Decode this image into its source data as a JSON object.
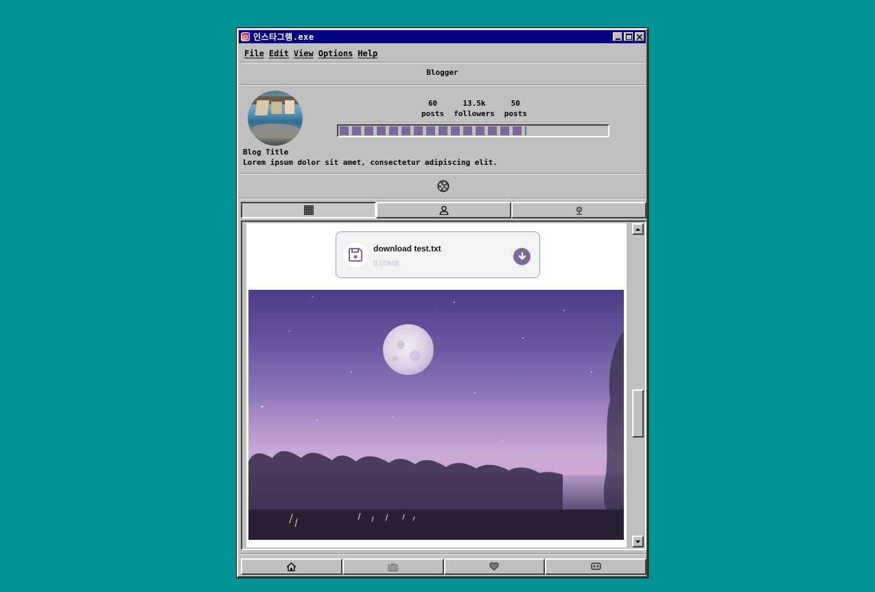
{
  "window": {
    "title": "인스타그램.exe",
    "app_icon": "instagram-icon",
    "controls": [
      "minimize-icon",
      "maximize-icon",
      "close-icon"
    ]
  },
  "menu": {
    "items": [
      {
        "label": "File"
      },
      {
        "label": "Edit"
      },
      {
        "label": "View"
      },
      {
        "label": "Options"
      },
      {
        "label": "Help"
      }
    ]
  },
  "header": {
    "title": "Blogger"
  },
  "profile": {
    "stats": [
      {
        "value": "60",
        "label": "posts"
      },
      {
        "value": "13.5k",
        "label": "followers"
      },
      {
        "value": "50",
        "label": "posts"
      }
    ],
    "progress_fraction": 0.7,
    "blog_title": "Blog Title",
    "description": "Lorem ipsum dolor sit amet, consectetur adipiscing elit.",
    "website_icon": "globe-icon"
  },
  "tabs": [
    {
      "icon": "grid-icon",
      "active": true
    },
    {
      "icon": "user-icon",
      "active": false
    },
    {
      "icon": "location-pin-icon",
      "active": false
    }
  ],
  "download": {
    "icon": "floppy-disk-icon",
    "filename": "download test.txt",
    "size": "0.00MB",
    "action_icon": "download-arrow-icon"
  },
  "post": {
    "image": "moon-night-sky-photo"
  },
  "bottom_nav": [
    {
      "icon": "home-icon"
    },
    {
      "icon": "tv-icon"
    },
    {
      "icon": "heart-icon"
    },
    {
      "icon": "message-icon"
    }
  ],
  "colors": {
    "desktop": "#009191",
    "titlebar": "#000080",
    "window": "#c0c0c0",
    "accent": "#7c6899"
  }
}
